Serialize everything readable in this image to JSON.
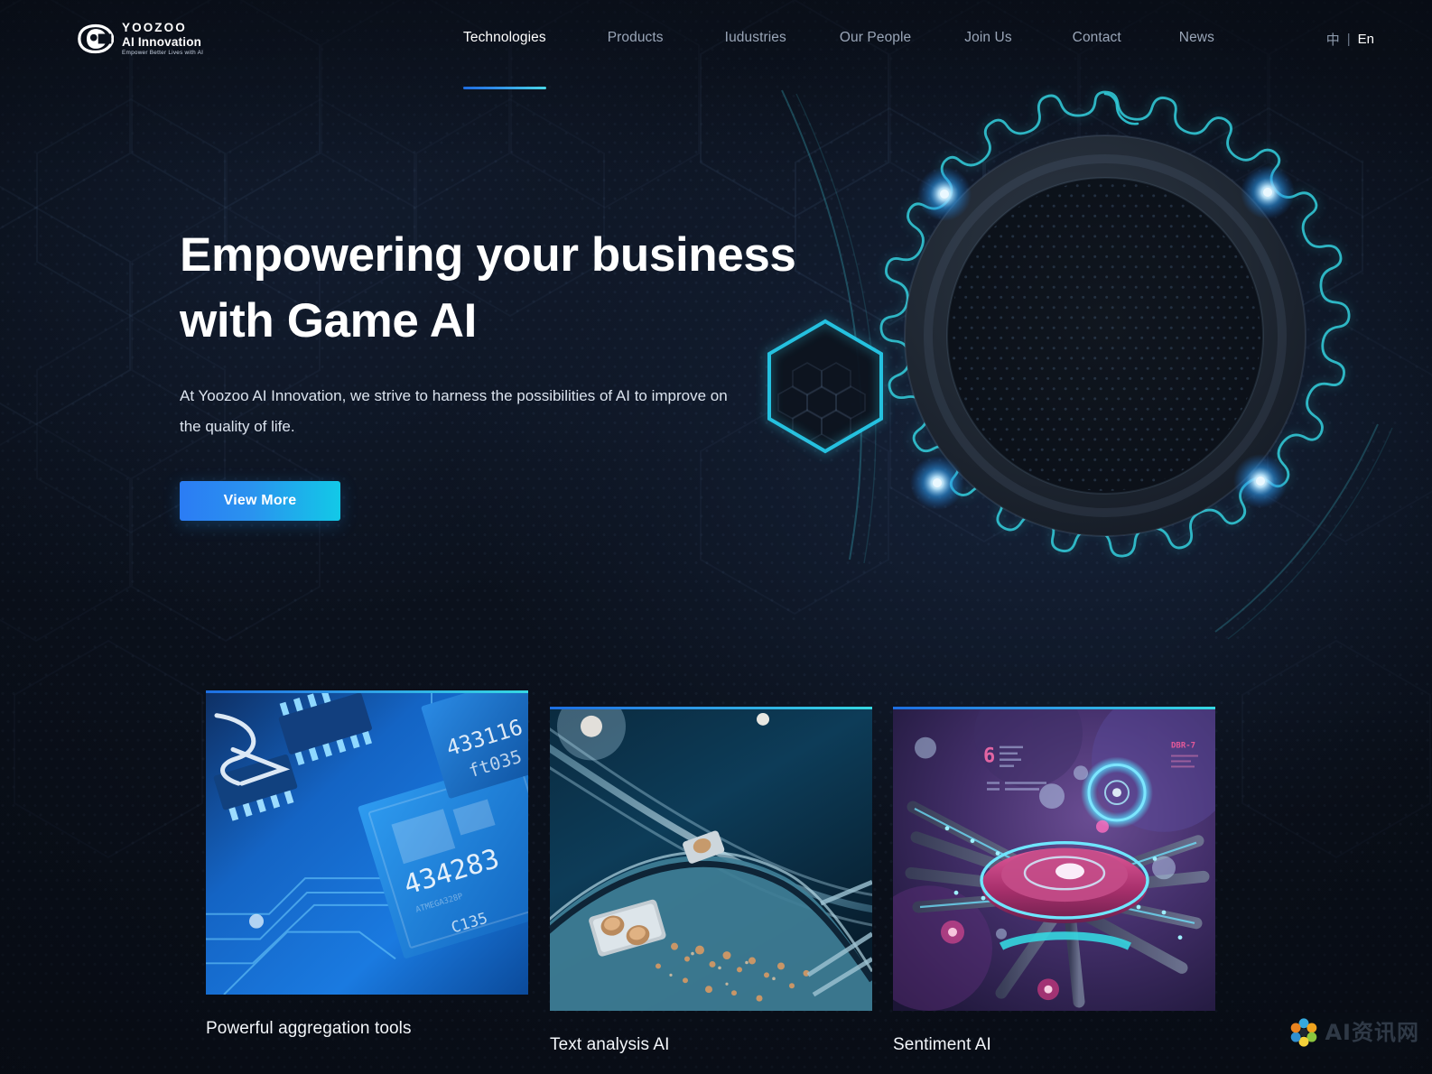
{
  "brand": {
    "logo_icon": "eye-logo-icon",
    "name_line1": "YOOZOO",
    "name_line2": "AI Innovation",
    "tagline": "Empower Better Lives with AI"
  },
  "nav": {
    "items": [
      {
        "label": "Technologies",
        "active": true
      },
      {
        "label": "Products",
        "active": false
      },
      {
        "label": "Iudustries",
        "active": false
      },
      {
        "label": "Our People",
        "active": false
      },
      {
        "label": "Join Us",
        "active": false
      },
      {
        "label": "Contact",
        "active": false
      },
      {
        "label": "News",
        "active": false
      }
    ],
    "lang": {
      "cn": "中",
      "separator": "|",
      "en": "En",
      "active": "En"
    }
  },
  "hero": {
    "title_line1": "Empowering your business",
    "title_line2": "with Game AI",
    "subtitle": "At Yoozoo AI Innovation, we strive to harness the possibilities of AI to improve on the quality of life.",
    "cta_label": "View More",
    "artwork": "glowing-gear-hexagon-graphic"
  },
  "cards": [
    {
      "title": "Powerful aggregation tools",
      "image": "circuit-board-chips-image"
    },
    {
      "title": "Text analysis AI",
      "image": "blue-mechanical-curve-image"
    },
    {
      "title": "Sentiment AI",
      "image": "purple-sci-fi-spacecraft-image"
    }
  ],
  "watermark": {
    "text": "AI资讯网",
    "logo": "flower-petals-icon"
  },
  "colors": {
    "background": "#0c121d",
    "accent_blue": "#2b7cf4",
    "accent_cyan": "#12c9e7",
    "nav_inactive": "#9aa6b8",
    "text_primary": "#ffffff",
    "text_secondary": "#dbe3ee"
  }
}
